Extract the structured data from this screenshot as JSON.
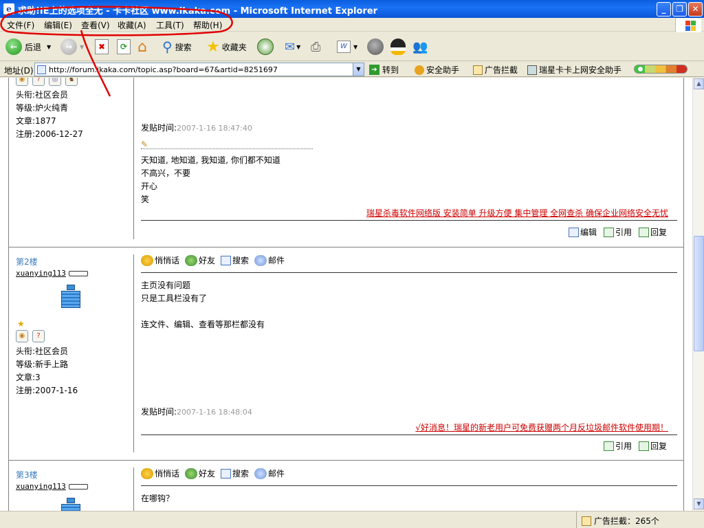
{
  "window": {
    "title": "求助!IE上的选项全无 - 卡卡社区 www.ikaka.com - Microsoft Internet Explorer"
  },
  "menu": [
    "文件(F)",
    "编辑(E)",
    "查看(V)",
    "收藏(A)",
    "工具(T)",
    "帮助(H)"
  ],
  "toolbar": {
    "back": "后退",
    "search": "搜索",
    "favorites": "收藏夹"
  },
  "addressbar": {
    "label": "地址(D)",
    "url": "http://forum.ikaka.com/topic.asp?board=67&artid=8251697",
    "go": "转到",
    "links": [
      "安全助手",
      "广告拦截",
      "瑞星卡卡上网安全助手"
    ]
  },
  "posts": [
    {
      "user": {
        "title_label": "头衔:社区会员",
        "level_label": "等级:炉火纯青",
        "articles_label": "文章:1877",
        "registered_label": "注册:2006-12-27"
      },
      "post_time_label": "发贴时间:",
      "post_time": "2007-1-16 18:47:40",
      "body": [
        "天知道, 地知道, 我知道, 你们都不知道",
        "不高兴，不要",
        "开心",
        "笑"
      ],
      "ad": "瑞星杀毒软件网络版 安装简单 升级方便 集中管理 全网查杀 确保企业网络安全无忧",
      "actions": [
        "编辑",
        "引用",
        "回复"
      ]
    },
    {
      "floor": "第2楼",
      "username": "xuanying113",
      "tools": [
        "悄悄话",
        "好友",
        "搜索",
        "邮件"
      ],
      "body": [
        "主页没有问题",
        "只是工具栏没有了",
        "",
        "连文件、编辑、查看等那栏都没有"
      ],
      "user": {
        "title_label": "头衔:社区会员",
        "level_label": "等级:新手上路",
        "articles_label": "文章:3",
        "registered_label": "注册:2007-1-16"
      },
      "post_time_label": "发贴时间:",
      "post_time": "2007-1-16 18:48:04",
      "ad": "√好消息！瑞星的新老用户可免费获赠两个月反垃圾邮件软件使用期！",
      "actions": [
        "引用",
        "回复"
      ]
    },
    {
      "floor": "第3楼",
      "username": "xuanying113",
      "tools": [
        "悄悄话",
        "好友",
        "搜索",
        "邮件"
      ],
      "body": [
        "在哪钩？"
      ]
    }
  ],
  "status": {
    "adblock": "广告拦截：265个"
  },
  "colors": {
    "accent": "#0a5ede",
    "annotation": "#e00000",
    "ad": "#cc0000",
    "floor": "#3a7bbf"
  }
}
